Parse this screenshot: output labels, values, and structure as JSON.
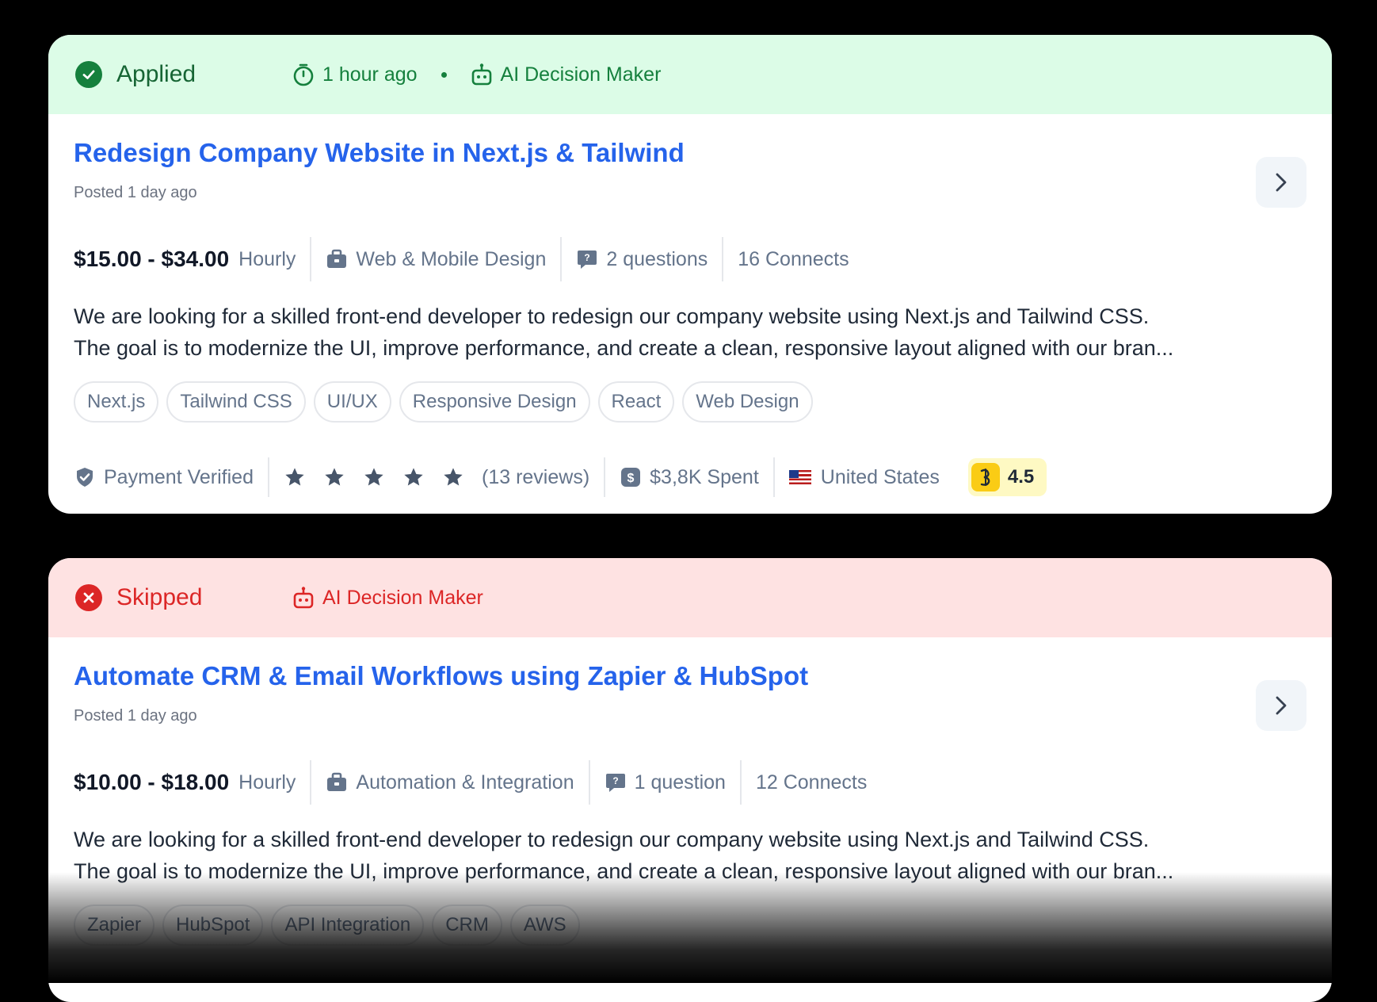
{
  "jobs": [
    {
      "status": "Applied",
      "time": "1 hour ago",
      "decision_maker": "AI Decision Maker",
      "title": "Redesign Company Website in Next.js & Tailwind",
      "posted": "Posted 1 day ago",
      "rate": "$15.00 - $34.00",
      "rate_type": "Hourly",
      "category": "Web & Mobile Design",
      "questions": "2 questions",
      "connects": "16 Connects",
      "description_line1": "We are looking for a skilled front-end developer to redesign our company website using Next.js and Tailwind CSS.",
      "description_line2": "The goal is to modernize the UI, improve performance, and create a clean, responsive layout aligned with our bran...",
      "tags": [
        "Next.js",
        "Tailwind CSS",
        "UI/UX",
        "Responsive Design",
        "React",
        "Web Design"
      ],
      "payment": "Payment Verified",
      "rating": 5,
      "reviews": "(13 reviews)",
      "spent": "$3,8K Spent",
      "country": "United States",
      "score": "4.5"
    },
    {
      "status": "Skipped",
      "decision_maker": "AI Decision Maker",
      "title": "Automate CRM & Email Workflows using Zapier & HubSpot",
      "posted": "Posted 1 day ago",
      "rate": "$10.00 - $18.00",
      "rate_type": "Hourly",
      "category": "Automation & Integration",
      "questions": "1 question",
      "connects": "12 Connects",
      "description_line1": "We are looking for a skilled front-end developer to redesign our company website using Next.js and Tailwind CSS.",
      "description_line2": "The goal is to modernize the UI, improve performance, and create a clean, responsive layout aligned with our bran...",
      "tags": [
        "Zapier",
        "HubSpot",
        "API Integration",
        "CRM",
        "AWS"
      ]
    }
  ],
  "colors": {
    "applied_bg": "#dcfce7",
    "applied_text": "#15803d",
    "skipped_bg": "#fee2e2",
    "skipped_text": "#dc2626",
    "title_link": "#2563eb"
  }
}
